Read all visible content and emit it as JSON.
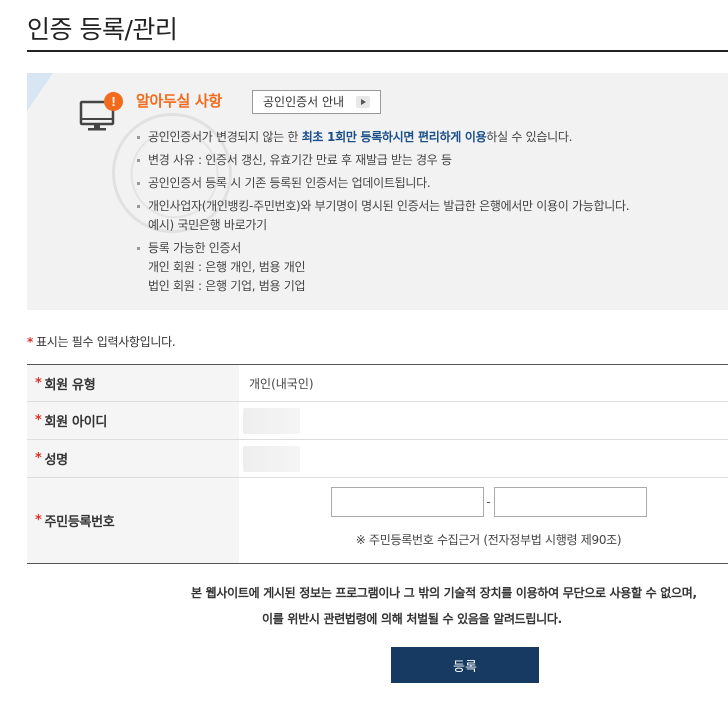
{
  "page": {
    "title": "인증 등록/관리"
  },
  "notice": {
    "heading": "알아두실 사항",
    "guide_button": "공인인증서 안내",
    "items": [
      {
        "pre": "공인인증서가 변경되지 않는 한 ",
        "highlight": "최초 1회만 등록하시면 편리하게 이용",
        "post": "하실 수 있습니다."
      },
      {
        "text": "변경 사유 : 인증서 갱신, 유효기간 만료 후 재발급 받는 경우 등"
      },
      {
        "text": "공인인증서 등록 시 기존 등록된 인증서는 업데이트됩니다."
      },
      {
        "text": "개인사업자(개인뱅킹-주민번호)와 부기명이 명시된 인증서는 발급한 은행에서만 이용이 가능합니다.",
        "sub": "예시) 국민은행 바로가기"
      },
      {
        "text": "등록 가능한 인증서",
        "sub1": "개인 회원 : 은행 개인, 범용 개인",
        "sub2": "법인 회원 : 은행 기업, 범용 기업"
      }
    ]
  },
  "form": {
    "required_star": "*",
    "required_note": "표시는 필수 입력사항입니다.",
    "rows": [
      {
        "label": "회원 유형",
        "value": "개인(내국인)"
      },
      {
        "label": "회원 아이디",
        "value": ""
      },
      {
        "label": "성명",
        "value": ""
      },
      {
        "label": "주민등록번호",
        "dash": "-",
        "note": "※ 주민등록번호 수집근거 (전자정부법 시행령 제90조)"
      }
    ]
  },
  "legal": {
    "line1": "본 웹사이트에 게시된 정보는 프로그램이나 그 밖의 기술적 장치를 이용하여 무단으로 사용할 수 없으며,",
    "line2": "이를 위반시 관련법령에 의해 처벌될 수 있음을 알려드립니다."
  },
  "submit": {
    "label": "등록"
  },
  "colors": {
    "accent": "#f26b1d",
    "highlight": "#1a4f8a",
    "required": "#d9342b",
    "button": "#173a63"
  }
}
